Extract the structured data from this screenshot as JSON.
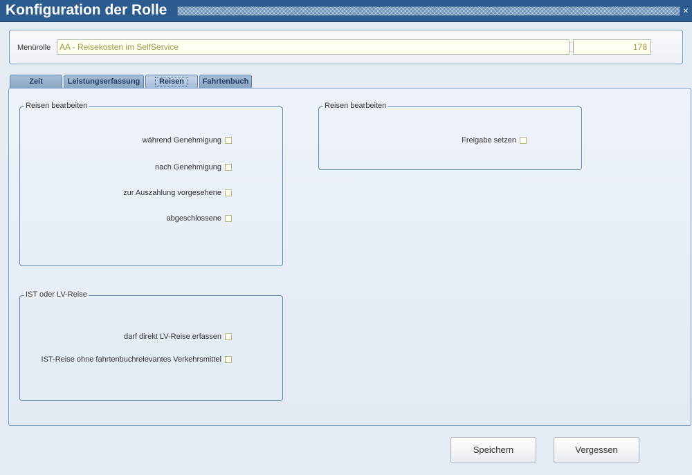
{
  "window": {
    "title": "Konfiguration der Rolle",
    "close_glyph": "×"
  },
  "header": {
    "menurolle_label": "Menürolle",
    "menurolle_value": "AA - Reisekosten im SelfService",
    "menurolle_id": "178"
  },
  "tabs": [
    {
      "label": "Zeit"
    },
    {
      "label": "Leistungserfassung"
    },
    {
      "label": "Reisen"
    },
    {
      "label": "Fahrtenbuch"
    }
  ],
  "active_tab": "Reisen",
  "groups": {
    "reisen_bearbeiten_left": {
      "title": "Reisen bearbeiten",
      "options": [
        {
          "label": "während Genehmigung",
          "checked": false
        },
        {
          "label": "nach Genehmigung",
          "checked": false
        },
        {
          "label": "zur Auszahlung vorgesehene",
          "checked": false
        },
        {
          "label": "abgeschlossene",
          "checked": false
        }
      ]
    },
    "reisen_bearbeiten_right": {
      "title": "Reisen bearbeiten",
      "options": [
        {
          "label": "Freigabe setzen",
          "checked": false
        }
      ]
    },
    "ist_lv_reise": {
      "title": "IST oder LV-Reise",
      "options": [
        {
          "label": "darf direkt LV-Reise erfassen",
          "checked": false
        },
        {
          "label": "IST-Reise ohne fahrtenbuchrelevantes Verkehrsmittel",
          "checked": false
        }
      ]
    }
  },
  "buttons": {
    "save": "Speichern",
    "discard": "Vergessen"
  },
  "colors": {
    "titlebar": "#2c5c8f",
    "panel_border": "#7a9cc6",
    "input_text": "#9a9a4a"
  }
}
